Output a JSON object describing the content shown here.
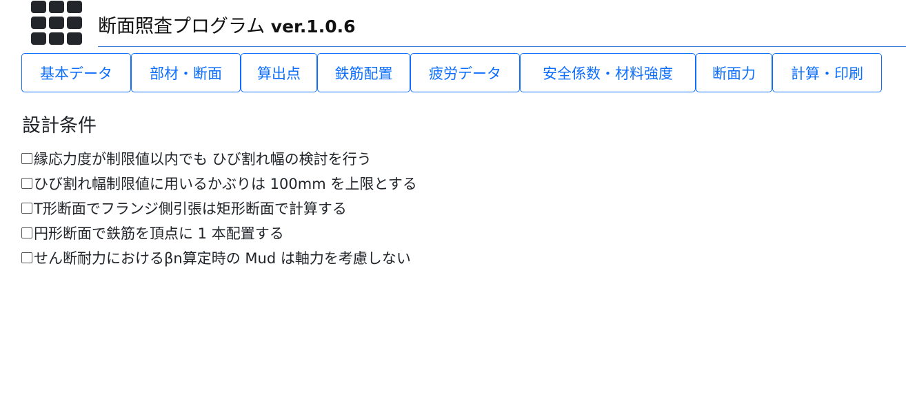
{
  "header": {
    "logo_icon": "grid-icon",
    "title": "断面照査プログラム",
    "version": "ver.1.0.6",
    "accent_color": "#0d6efd"
  },
  "tabs": [
    {
      "label": "基本データ"
    },
    {
      "label": "部材・断面"
    },
    {
      "label": "算出点"
    },
    {
      "label": "鉄筋配置"
    },
    {
      "label": "疲労データ"
    },
    {
      "label": "安全係数・材料強度"
    },
    {
      "label": "断面力"
    },
    {
      "label": "計算・印刷"
    }
  ],
  "design_conditions": {
    "heading": "設計条件",
    "options": [
      {
        "label": "縁応力度が制限値以内でも ひび割れ幅の検討を行う",
        "checked": false
      },
      {
        "label": "ひび割れ幅制限値に用いるかぶりは 100mm を上限とする",
        "checked": false
      },
      {
        "label": "T形断面でフランジ側引張は矩形断面で計算する",
        "checked": false
      },
      {
        "label": "円形断面で鉄筋を頂点に 1 本配置する",
        "checked": false
      },
      {
        "label": "せん断耐力におけるβn算定時の Mud は軸力を考慮しない",
        "checked": false
      }
    ]
  }
}
